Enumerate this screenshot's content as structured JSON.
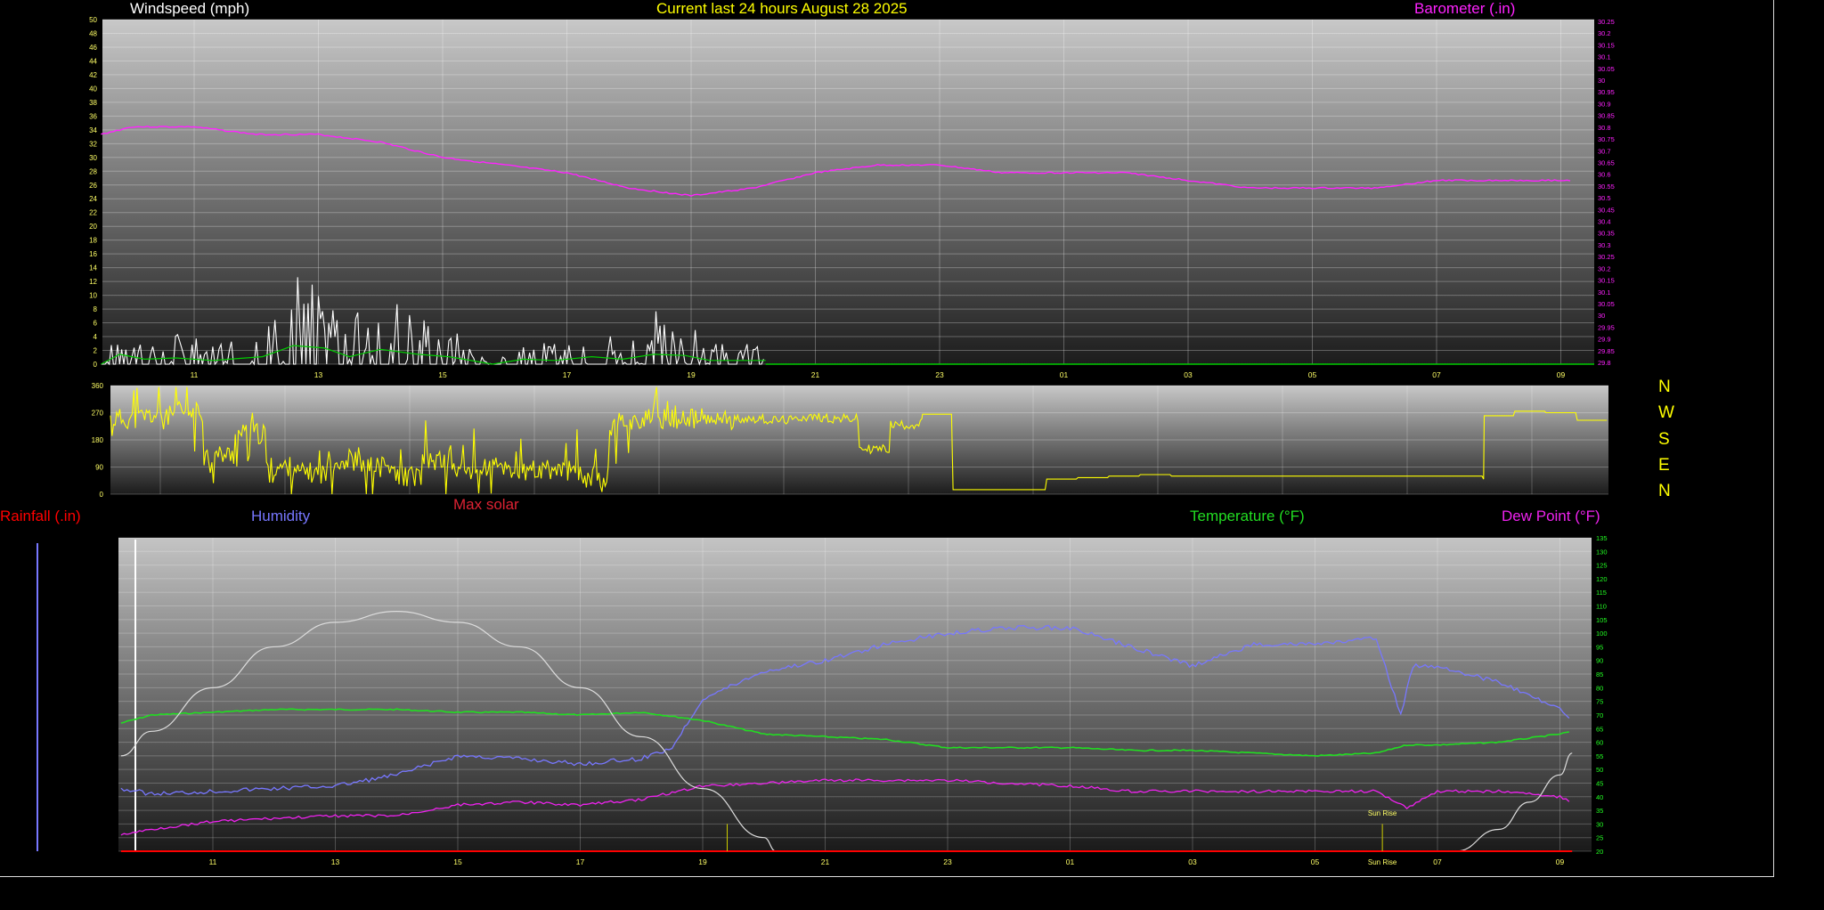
{
  "header": {
    "title": "Current last 24 hours August 28 2025",
    "windspeed_label": "Windspeed (mph)",
    "barometer_label": "Barometer (.in)"
  },
  "legend": {
    "rainfall": "Rainfall (.in)",
    "humidity": "Humidity",
    "max_solar": "Max solar",
    "temperature": "Temperature (°F)",
    "dewpoint": "Dew Point (°F)"
  },
  "compass": [
    "N",
    "W",
    "S",
    "E",
    "N"
  ],
  "colors": {
    "windspeed": "#ffffff",
    "gust_green": "#00cc00",
    "barometer": "#ff22ff",
    "direction": "#ffff00",
    "humidity": "#7777ff",
    "temperature": "#22dd22",
    "dewpoint": "#ee22ee",
    "solar": "#dddddd",
    "rainfall": "#ff0000",
    "title": "#ffff00",
    "axis_left_bottom": "#ff3333"
  },
  "chart_data": [
    {
      "type": "line",
      "name": "wind-barometer",
      "x_ticks": [
        "11",
        "13",
        "15",
        "17",
        "19",
        "21",
        "23",
        "01",
        "03",
        "05",
        "07",
        "09"
      ],
      "wind_ticks": [
        "0",
        "2",
        "4",
        "6",
        "8",
        "10",
        "12",
        "14",
        "16",
        "18",
        "20",
        "22",
        "24",
        "26",
        "28",
        "30",
        "32",
        "34",
        "36",
        "38",
        "40",
        "42",
        "44",
        "46",
        "48",
        "50"
      ],
      "baro_ticks": [
        "29.8",
        "29.85",
        "29.9",
        "29.95",
        "30",
        "30.05",
        "30.1",
        "30.15",
        "30.2",
        "30.25",
        "30.3",
        "30.35",
        "30.4",
        "30.45",
        "30.5",
        "30.55",
        "30.6",
        "30.65",
        "30.7",
        "30.75",
        "30.8",
        "30.85",
        "30.9",
        "30.95",
        "30",
        "30.05",
        "30.1",
        "30.15",
        "30.2",
        "30.25"
      ],
      "ylim_wind": [
        0,
        50
      ],
      "ylim_baro": [
        29.8,
        30.25
      ],
      "series": [
        {
          "name": "Windspeed (mph)",
          "x": [
            9.5,
            9.8,
            10.2,
            10.7,
            11.3,
            12.1,
            12.6,
            13.1,
            13.5,
            14.0,
            14.6,
            15.1,
            15.8,
            16.3,
            16.8,
            17.4,
            17.9,
            18.4,
            18.9,
            19.3,
            20.2
          ],
          "values": [
            0,
            8,
            4,
            5,
            3,
            6,
            15,
            13,
            6,
            12,
            8,
            6,
            0,
            4,
            3,
            6,
            4,
            8,
            7,
            3,
            3
          ]
        },
        {
          "name": "Barometer (.in)",
          "x": [
            9.5,
            10,
            11,
            12,
            13,
            14,
            15,
            16,
            17,
            18,
            19,
            20,
            21,
            22,
            23,
            24,
            25,
            26,
            27,
            28,
            29,
            30,
            31,
            32,
            33,
            33.2
          ],
          "values": [
            30.1,
            30.11,
            30.11,
            30.1,
            30.1,
            30.09,
            30.07,
            30.06,
            30.05,
            30.03,
            30.02,
            30.03,
            30.05,
            30.06,
            30.06,
            30.05,
            30.05,
            30.05,
            30.04,
            30.03,
            30.03,
            30.03,
            30.04,
            30.04,
            30.04,
            30.04
          ]
        }
      ]
    },
    {
      "type": "line",
      "name": "wind-direction",
      "y_ticks": [
        "0",
        "90",
        "180",
        "270",
        "360"
      ],
      "ylim": [
        0,
        360
      ],
      "series": [
        {
          "name": "direction",
          "x": [
            9.5,
            10,
            10.5,
            11,
            11.5,
            12,
            12.5,
            13,
            13.5,
            14,
            14.5,
            15,
            15.5,
            16,
            16.5,
            17,
            17.5,
            18,
            18.5,
            19,
            19.5,
            20,
            20.5,
            21,
            21.5,
            22,
            22.5,
            22.51,
            23,
            24,
            24.5,
            25,
            25.5,
            26,
            26.5,
            27,
            28,
            29,
            30,
            31,
            31.5,
            31.51,
            32,
            32.5,
            33,
            33.5
          ],
          "values": [
            250,
            260,
            270,
            130,
            200,
            90,
            70,
            110,
            90,
            60,
            110,
            80,
            90,
            70,
            80,
            60,
            240,
            250,
            250,
            245,
            250,
            245,
            255,
            250,
            150,
            230,
            250,
            265,
            15,
            15,
            50,
            55,
            60,
            65,
            60,
            60,
            60,
            60,
            60,
            60,
            50,
            260,
            275,
            270,
            245,
            250
          ]
        }
      ]
    },
    {
      "type": "line",
      "name": "temperature-humidity",
      "x_ticks": [
        "11",
        "13",
        "15",
        "17",
        "19",
        "21",
        "23",
        "01",
        "03",
        "05",
        "07",
        "09"
      ],
      "temp_ticks": [
        "20",
        "25",
        "30",
        "35",
        "40",
        "45",
        "50",
        "55",
        "60",
        "65",
        "70",
        "75",
        "80",
        "85",
        "90",
        "95",
        "100",
        "105",
        "110",
        "115",
        "120",
        "125",
        "130",
        "135"
      ],
      "ylim_temp": [
        20,
        135
      ],
      "annotations": [
        "Sun Rise"
      ],
      "series": [
        {
          "name": "Temperature (°F)",
          "x": [
            9.5,
            10,
            11,
            12,
            13,
            14,
            15,
            16,
            17,
            18,
            19,
            20,
            21,
            22,
            23,
            24,
            25,
            26,
            27,
            28,
            29,
            30,
            30.5,
            31,
            32,
            33,
            33.2
          ],
          "values": [
            67,
            70,
            71,
            72,
            72,
            72,
            71,
            71,
            70,
            71,
            68,
            63,
            62,
            61,
            58,
            58,
            58,
            57,
            57,
            56,
            55,
            56,
            59,
            59,
            60,
            63,
            64
          ]
        },
        {
          "name": "Humidity",
          "x": [
            9.5,
            10,
            11,
            12,
            13,
            14,
            15,
            16,
            17,
            18,
            18.5,
            19,
            20,
            21,
            22,
            23,
            24,
            25,
            26,
            27,
            28,
            29,
            30,
            30.4,
            30.6,
            31,
            32,
            33,
            33.2
          ],
          "values": [
            43,
            41,
            42,
            43,
            44,
            48,
            55,
            54,
            52,
            54,
            58,
            76,
            86,
            90,
            96,
            100,
            102,
            102,
            95,
            88,
            96,
            96,
            98,
            70,
            88,
            88,
            82,
            72,
            67
          ]
        },
        {
          "name": "Dew Point (°F)",
          "x": [
            9.5,
            10,
            11,
            12,
            13,
            14,
            15,
            16,
            17,
            18,
            19,
            20,
            21,
            22,
            23,
            24,
            25,
            26,
            27,
            28,
            29,
            30,
            30.5,
            31,
            32,
            33,
            33.2
          ],
          "values": [
            26,
            28,
            31,
            32,
            33,
            33,
            37,
            38,
            37,
            39,
            44,
            45,
            46,
            46,
            46,
            45,
            44,
            42,
            42,
            42,
            42,
            42,
            36,
            42,
            42,
            40,
            38
          ]
        },
        {
          "name": "Max solar",
          "x": [
            9.5,
            10,
            11,
            12,
            13,
            14,
            15,
            16,
            17,
            18,
            19,
            20,
            20.2,
            31.3,
            32,
            32.5,
            33,
            33.2
          ],
          "values": [
            55,
            64,
            80,
            95,
            104,
            108,
            104,
            95,
            80,
            62,
            43,
            25,
            20,
            20,
            28,
            38,
            48,
            56
          ]
        },
        {
          "name": "Rainfall (.in)",
          "x": [
            9.5,
            33.2
          ],
          "values": [
            0,
            0
          ]
        }
      ]
    }
  ]
}
